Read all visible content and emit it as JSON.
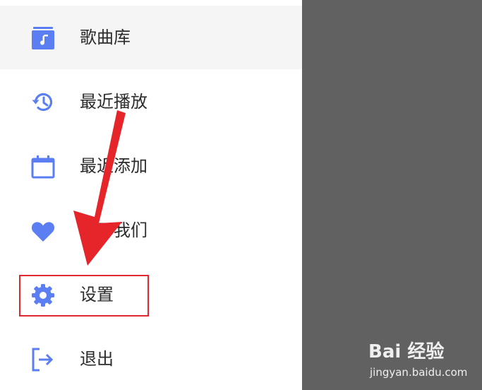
{
  "menu": {
    "items": [
      {
        "label": "歌曲库",
        "icon": "music-library-icon",
        "active": true
      },
      {
        "label": "最近播放",
        "icon": "history-icon",
        "active": false
      },
      {
        "label": "最近添加",
        "icon": "calendar-icon",
        "active": false
      },
      {
        "label": "关于我们",
        "icon": "heart-icon",
        "active": false
      },
      {
        "label": "设置",
        "icon": "gear-icon",
        "active": false
      },
      {
        "label": "退出",
        "icon": "logout-icon",
        "active": false
      }
    ]
  },
  "annotation": {
    "highlight_target": "设置",
    "color": "#e0282e"
  },
  "watermark": {
    "logo_text": "Bai 经验",
    "url": "jingyan.baidu.com"
  },
  "colors": {
    "icon_accent": "#5b7ff2",
    "active_row": "#f5f5f5",
    "scrim": "#616161",
    "text": "#2b2b2b"
  }
}
